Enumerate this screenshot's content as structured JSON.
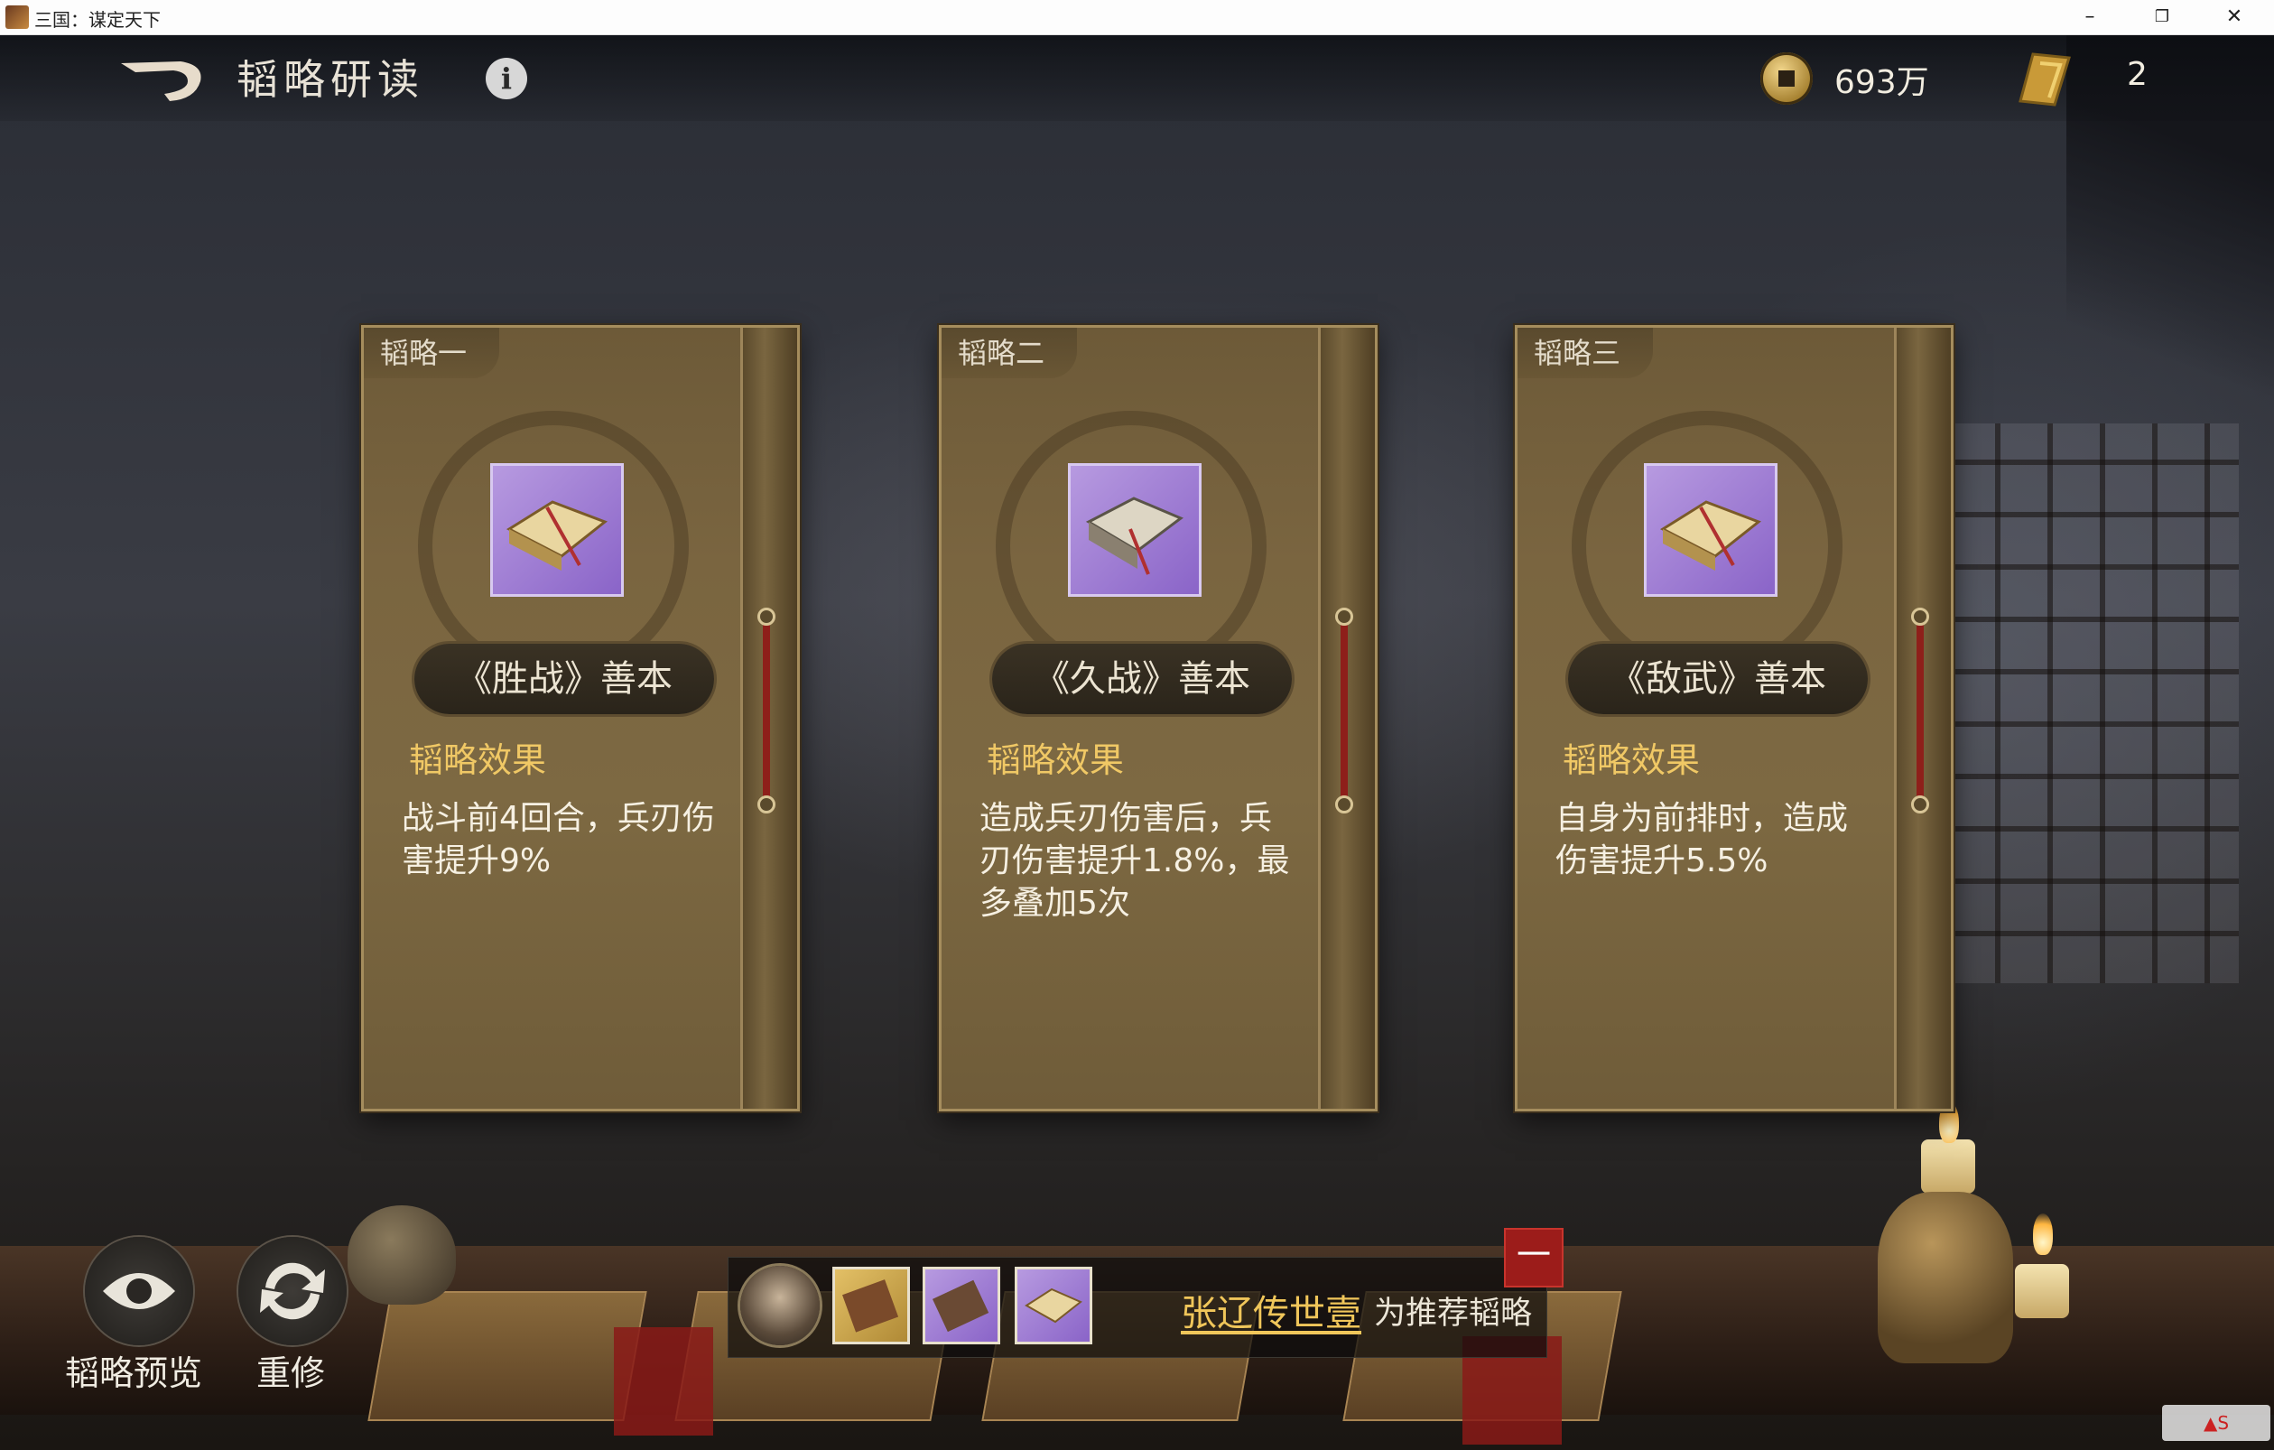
{
  "window": {
    "title": "三国：谋定天下"
  },
  "header": {
    "title": "韬略研读",
    "info_glyph": "i",
    "coin_value": "693万",
    "scroll_value": "2"
  },
  "cards": [
    {
      "tab": "韬略一",
      "name": "《胜战》善本",
      "effect_title": "韬略效果",
      "effect_text": "战斗前4回合，兵刃伤害提升9%"
    },
    {
      "tab": "韬略二",
      "name": "《久战》善本",
      "effect_title": "韬略效果",
      "effect_text": "造成兵刃伤害后，兵刃伤害提升1.8%，最多叠加5次"
    },
    {
      "tab": "韬略三",
      "name": "《敌武》善本",
      "effect_title": "韬略效果",
      "effect_text": "自身为前排时，造成伤害提升5.5%"
    }
  ],
  "controls": {
    "preview_label": "韬略预览",
    "reforge_label": "重修"
  },
  "recommend": {
    "hero_name": "张辽传世壹",
    "suffix": "为推荐韬略",
    "tag": "一"
  },
  "colors": {
    "accent_gold": "#f0c865",
    "card_bg": "#7a6540",
    "item_purple": "#8a64c8",
    "tag_red": "#9c1c1a"
  }
}
